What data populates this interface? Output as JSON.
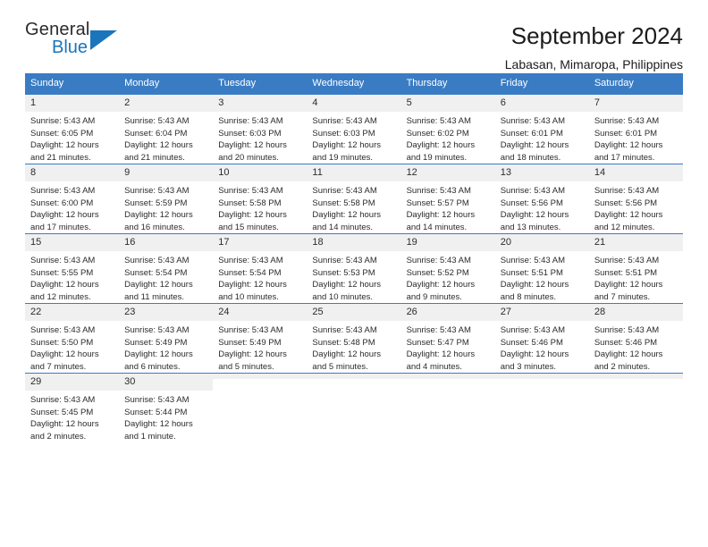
{
  "brand": {
    "name_top": "General",
    "name_bottom": "Blue",
    "accent_color": "#1b75bb"
  },
  "header": {
    "title": "September 2024",
    "subtitle": "Labasan, Mimaropa, Philippines"
  },
  "theme": {
    "header_row_color": "#3a7cc4",
    "daynum_strip_color": "#f0f0f0",
    "text_color": "#2b2b2b"
  },
  "weekdays": [
    "Sunday",
    "Monday",
    "Tuesday",
    "Wednesday",
    "Thursday",
    "Friday",
    "Saturday"
  ],
  "weeks": [
    [
      {
        "day": "1",
        "sunrise": "Sunrise: 5:43 AM",
        "sunset": "Sunset: 6:05 PM",
        "daylight_1": "Daylight: 12 hours",
        "daylight_2": "and 21 minutes."
      },
      {
        "day": "2",
        "sunrise": "Sunrise: 5:43 AM",
        "sunset": "Sunset: 6:04 PM",
        "daylight_1": "Daylight: 12 hours",
        "daylight_2": "and 21 minutes."
      },
      {
        "day": "3",
        "sunrise": "Sunrise: 5:43 AM",
        "sunset": "Sunset: 6:03 PM",
        "daylight_1": "Daylight: 12 hours",
        "daylight_2": "and 20 minutes."
      },
      {
        "day": "4",
        "sunrise": "Sunrise: 5:43 AM",
        "sunset": "Sunset: 6:03 PM",
        "daylight_1": "Daylight: 12 hours",
        "daylight_2": "and 19 minutes."
      },
      {
        "day": "5",
        "sunrise": "Sunrise: 5:43 AM",
        "sunset": "Sunset: 6:02 PM",
        "daylight_1": "Daylight: 12 hours",
        "daylight_2": "and 19 minutes."
      },
      {
        "day": "6",
        "sunrise": "Sunrise: 5:43 AM",
        "sunset": "Sunset: 6:01 PM",
        "daylight_1": "Daylight: 12 hours",
        "daylight_2": "and 18 minutes."
      },
      {
        "day": "7",
        "sunrise": "Sunrise: 5:43 AM",
        "sunset": "Sunset: 6:01 PM",
        "daylight_1": "Daylight: 12 hours",
        "daylight_2": "and 17 minutes."
      }
    ],
    [
      {
        "day": "8",
        "sunrise": "Sunrise: 5:43 AM",
        "sunset": "Sunset: 6:00 PM",
        "daylight_1": "Daylight: 12 hours",
        "daylight_2": "and 17 minutes."
      },
      {
        "day": "9",
        "sunrise": "Sunrise: 5:43 AM",
        "sunset": "Sunset: 5:59 PM",
        "daylight_1": "Daylight: 12 hours",
        "daylight_2": "and 16 minutes."
      },
      {
        "day": "10",
        "sunrise": "Sunrise: 5:43 AM",
        "sunset": "Sunset: 5:58 PM",
        "daylight_1": "Daylight: 12 hours",
        "daylight_2": "and 15 minutes."
      },
      {
        "day": "11",
        "sunrise": "Sunrise: 5:43 AM",
        "sunset": "Sunset: 5:58 PM",
        "daylight_1": "Daylight: 12 hours",
        "daylight_2": "and 14 minutes."
      },
      {
        "day": "12",
        "sunrise": "Sunrise: 5:43 AM",
        "sunset": "Sunset: 5:57 PM",
        "daylight_1": "Daylight: 12 hours",
        "daylight_2": "and 14 minutes."
      },
      {
        "day": "13",
        "sunrise": "Sunrise: 5:43 AM",
        "sunset": "Sunset: 5:56 PM",
        "daylight_1": "Daylight: 12 hours",
        "daylight_2": "and 13 minutes."
      },
      {
        "day": "14",
        "sunrise": "Sunrise: 5:43 AM",
        "sunset": "Sunset: 5:56 PM",
        "daylight_1": "Daylight: 12 hours",
        "daylight_2": "and 12 minutes."
      }
    ],
    [
      {
        "day": "15",
        "sunrise": "Sunrise: 5:43 AM",
        "sunset": "Sunset: 5:55 PM",
        "daylight_1": "Daylight: 12 hours",
        "daylight_2": "and 12 minutes."
      },
      {
        "day": "16",
        "sunrise": "Sunrise: 5:43 AM",
        "sunset": "Sunset: 5:54 PM",
        "daylight_1": "Daylight: 12 hours",
        "daylight_2": "and 11 minutes."
      },
      {
        "day": "17",
        "sunrise": "Sunrise: 5:43 AM",
        "sunset": "Sunset: 5:54 PM",
        "daylight_1": "Daylight: 12 hours",
        "daylight_2": "and 10 minutes."
      },
      {
        "day": "18",
        "sunrise": "Sunrise: 5:43 AM",
        "sunset": "Sunset: 5:53 PM",
        "daylight_1": "Daylight: 12 hours",
        "daylight_2": "and 10 minutes."
      },
      {
        "day": "19",
        "sunrise": "Sunrise: 5:43 AM",
        "sunset": "Sunset: 5:52 PM",
        "daylight_1": "Daylight: 12 hours",
        "daylight_2": "and 9 minutes."
      },
      {
        "day": "20",
        "sunrise": "Sunrise: 5:43 AM",
        "sunset": "Sunset: 5:51 PM",
        "daylight_1": "Daylight: 12 hours",
        "daylight_2": "and 8 minutes."
      },
      {
        "day": "21",
        "sunrise": "Sunrise: 5:43 AM",
        "sunset": "Sunset: 5:51 PM",
        "daylight_1": "Daylight: 12 hours",
        "daylight_2": "and 7 minutes."
      }
    ],
    [
      {
        "day": "22",
        "sunrise": "Sunrise: 5:43 AM",
        "sunset": "Sunset: 5:50 PM",
        "daylight_1": "Daylight: 12 hours",
        "daylight_2": "and 7 minutes."
      },
      {
        "day": "23",
        "sunrise": "Sunrise: 5:43 AM",
        "sunset": "Sunset: 5:49 PM",
        "daylight_1": "Daylight: 12 hours",
        "daylight_2": "and 6 minutes."
      },
      {
        "day": "24",
        "sunrise": "Sunrise: 5:43 AM",
        "sunset": "Sunset: 5:49 PM",
        "daylight_1": "Daylight: 12 hours",
        "daylight_2": "and 5 minutes."
      },
      {
        "day": "25",
        "sunrise": "Sunrise: 5:43 AM",
        "sunset": "Sunset: 5:48 PM",
        "daylight_1": "Daylight: 12 hours",
        "daylight_2": "and 5 minutes."
      },
      {
        "day": "26",
        "sunrise": "Sunrise: 5:43 AM",
        "sunset": "Sunset: 5:47 PM",
        "daylight_1": "Daylight: 12 hours",
        "daylight_2": "and 4 minutes."
      },
      {
        "day": "27",
        "sunrise": "Sunrise: 5:43 AM",
        "sunset": "Sunset: 5:46 PM",
        "daylight_1": "Daylight: 12 hours",
        "daylight_2": "and 3 minutes."
      },
      {
        "day": "28",
        "sunrise": "Sunrise: 5:43 AM",
        "sunset": "Sunset: 5:46 PM",
        "daylight_1": "Daylight: 12 hours",
        "daylight_2": "and 2 minutes."
      }
    ],
    [
      {
        "day": "29",
        "sunrise": "Sunrise: 5:43 AM",
        "sunset": "Sunset: 5:45 PM",
        "daylight_1": "Daylight: 12 hours",
        "daylight_2": "and 2 minutes."
      },
      {
        "day": "30",
        "sunrise": "Sunrise: 5:43 AM",
        "sunset": "Sunset: 5:44 PM",
        "daylight_1": "Daylight: 12 hours",
        "daylight_2": "and 1 minute."
      },
      {
        "day": "",
        "sunrise": "",
        "sunset": "",
        "daylight_1": "",
        "daylight_2": ""
      },
      {
        "day": "",
        "sunrise": "",
        "sunset": "",
        "daylight_1": "",
        "daylight_2": ""
      },
      {
        "day": "",
        "sunrise": "",
        "sunset": "",
        "daylight_1": "",
        "daylight_2": ""
      },
      {
        "day": "",
        "sunrise": "",
        "sunset": "",
        "daylight_1": "",
        "daylight_2": ""
      },
      {
        "day": "",
        "sunrise": "",
        "sunset": "",
        "daylight_1": "",
        "daylight_2": ""
      }
    ]
  ]
}
